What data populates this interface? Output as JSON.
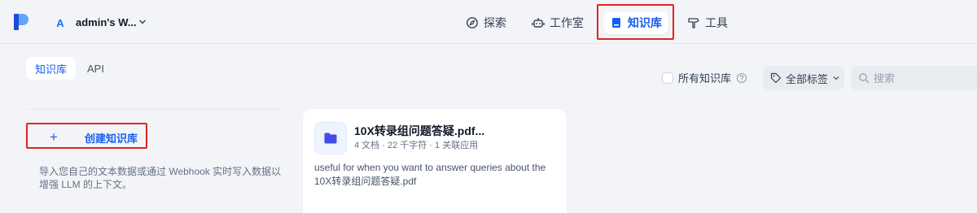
{
  "header": {
    "workspace_initial": "A",
    "workspace_name": "admin's W...",
    "nav": {
      "explore": "探索",
      "studio": "工作室",
      "knowledge": "知识库",
      "tools": "工具"
    }
  },
  "tabs": {
    "knowledge": "知识库",
    "api": "API"
  },
  "filters": {
    "all_knowledge_label": "所有知识库",
    "tag_label": "全部标签",
    "search_placeholder": "搜索"
  },
  "create": {
    "icon": "+",
    "label": "创建知识库",
    "description": "导入您自己的文本数据或通过 Webhook 实时写入数据以增强 LLM 的上下文。"
  },
  "knowledge_card": {
    "title": "10X转录组问题答疑.pdf...",
    "meta": "4 文档 · 22 千字符 · 1 关联应用",
    "description": "useful for when you want to answer queries about the 10X转录组问题答疑.pdf"
  },
  "colors": {
    "accent": "#155eef",
    "highlight_box": "#e02424",
    "background": "#f2f4f7"
  }
}
